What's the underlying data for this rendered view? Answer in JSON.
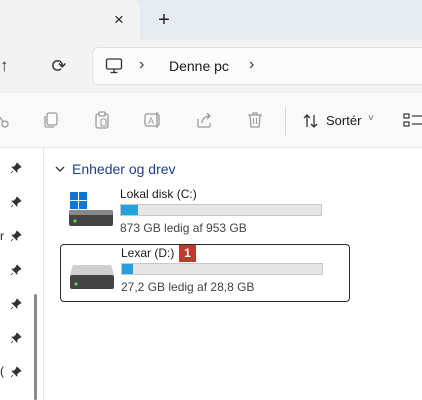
{
  "tabbar": {
    "close_glyph": "×",
    "new_tab_glyph": "+"
  },
  "nav": {
    "up_glyph": "↑",
    "refresh_glyph": "⟳"
  },
  "address": {
    "location_icon": "this-pc-icon",
    "separator": "›",
    "current": "Denne pc"
  },
  "toolbar": {
    "icons": [
      "cut-icon",
      "copy-icon",
      "paste-icon",
      "rename-icon",
      "share-icon",
      "delete-icon"
    ],
    "sort_label": "Sortér",
    "sort_chevron": "˅",
    "view_icon": "view-options-icon"
  },
  "sidebar": {
    "pins": 6,
    "fragments": [
      "r",
      "("
    ]
  },
  "group": {
    "title": "Enheder og drev",
    "expanded": true
  },
  "drives": [
    {
      "name": "Lokal disk (C:)",
      "free_text": "873 GB ledig af 953 GB",
      "used_fraction": 0.084,
      "icon": "windows-drive-icon",
      "selected": false
    },
    {
      "name": "Lexar (D:)",
      "free_text": "27,2 GB ledig af 28,8 GB",
      "used_fraction": 0.056,
      "icon": "usb-drive-icon",
      "selected": true,
      "badge": "1"
    }
  ],
  "colors": {
    "accent": "#26a0da",
    "group_title": "#1c3f8a",
    "badge": "#c0392b"
  }
}
